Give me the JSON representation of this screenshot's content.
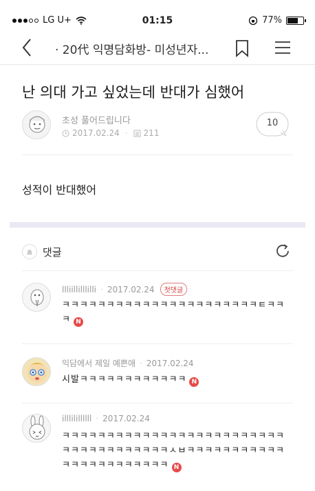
{
  "status_bar": {
    "carrier": "LG U+",
    "time": "01:15",
    "battery": "77%",
    "battery_level": 0.77
  },
  "nav": {
    "title": "· 20代 익명담화방- 미성년자...",
    "back_icon": "chevron-left-icon",
    "bookmark_icon": "bookmark-icon",
    "menu_icon": "hamburger-menu-icon"
  },
  "post": {
    "title": "난 의대 가고 싶었는데 반대가 심했어",
    "author": "초성 풀어드립니다",
    "date": "2017.02.24",
    "views": "211",
    "comment_count": "10",
    "body": "성적이 반대했어"
  },
  "comments_section": {
    "label": "댓글",
    "icon": "bell-icon",
    "refresh_icon": "refresh-icon"
  },
  "comments": [
    {
      "author": "llliillilllilli",
      "date": "2017.02.24",
      "badge": "첫댓글",
      "text": "ㅋㅋㅋㅋㅋㅋㅋㅋㅋㅋㅋㅋㅋㅋㅋㅋㅋㅋㅋㅋㅋㅋㅌㅋㅋㅋ",
      "new_badge": "N"
    },
    {
      "author": "익담에서 제일 예쁜애",
      "date": "2017.02.24",
      "badge": "",
      "text": "시발ㅋㅋㅋㅋㅋㅋㅋㅋㅋㅋㅋㅋ",
      "new_badge": "N"
    },
    {
      "author": "illlilillllll",
      "date": "2017.02.24",
      "badge": "",
      "text": "ㅋㅋㅋㅋㅋㅋㅋㅋㅋㅋㅋㅋㅋㅋㅋㅋㅋㅋㅋㅋㅋㅋㅋㅋㅋㅋㅋㅋㅋㅋㅋㅋㅋㅋㅋㅋㅋㅅㅂㅋㅋㅋㅋㅋㅋㅋㅋㅋㅋㅋㅋㅋㅋㅋㅋㅋㅋㅋㅋㅋㅋㅋ",
      "new_badge": "N"
    }
  ]
}
